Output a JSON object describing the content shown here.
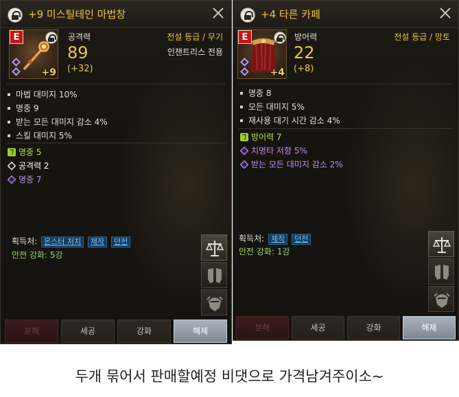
{
  "left_item": {
    "title": "+9 미스틸테인 마법창",
    "grade_badge": "E",
    "enhance_level": "+9",
    "stat_label": "공격력",
    "stat_value": "89",
    "stat_bonus": "(+32)",
    "grade_text": "전설 등급 / 무기",
    "restriction": "인챈트리스 전용",
    "options": [
      "마법 대미지 10%",
      "명중 9",
      "받는 모든 대미지 감소 4%",
      "스킬 대미지 5%"
    ],
    "gem_options": [
      {
        "text": "명중 5",
        "icon": "card-icon",
        "color": "green"
      },
      {
        "text": "공격력 2",
        "icon": "diamond-white-icon",
        "color": "white"
      },
      {
        "text": "명중 7",
        "icon": "diamond-purple-icon",
        "color": "purple"
      }
    ],
    "obtain_label": "획득처:",
    "sources": [
      "몬스터 처치",
      "제작",
      "던전"
    ],
    "safe_enhance": "안전 강화: 5강",
    "buttons": [
      "분해",
      "세공",
      "강화",
      "해제"
    ]
  },
  "right_item": {
    "title": "+4 타른 카페",
    "grade_badge": "E",
    "enhance_level": "+4",
    "stat_label": "방어력",
    "stat_value": "22",
    "stat_bonus": "(+8)",
    "grade_text": "전설 등급 / 망토",
    "options": [
      "명중 8",
      "모든 대미지 5%",
      "재사용 대기 시간 감소 4%"
    ],
    "gem_options": [
      {
        "text": "방어력 7",
        "icon": "card-icon",
        "color": "green"
      },
      {
        "text": "치명타 저항 5%",
        "icon": "diamond-purple-icon",
        "color": "purple"
      },
      {
        "text": "받는 모든 대미지 감소 2%",
        "icon": "diamond-purple-icon",
        "color": "purple"
      }
    ],
    "obtain_label": "획득처:",
    "sources": [
      "제작",
      "던전"
    ],
    "safe_enhance": "안전 강화: 1강",
    "buttons": [
      "분해",
      "세공",
      "강화",
      "해제"
    ]
  },
  "caption": "두개 묶어서 판매할예정 비댓으로 가격남겨주이소~",
  "colors": {
    "title": "#f2c23c",
    "stat": "#ecc650",
    "grade_badge": "#c7151b",
    "gem_green": "#b4e24e",
    "gem_purple": "#b98ff0",
    "link": "#74c7ff"
  }
}
